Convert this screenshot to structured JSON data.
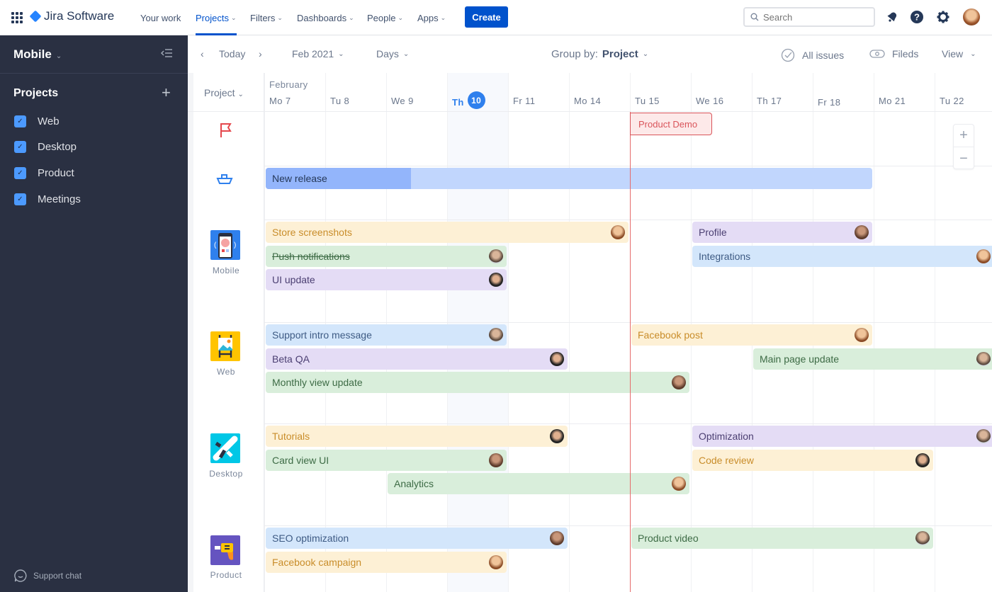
{
  "topbar": {
    "brand": "Jira Software",
    "nav": [
      {
        "label": "Your work",
        "dropdown": false,
        "active": false
      },
      {
        "label": "Projects",
        "dropdown": true,
        "active": true
      },
      {
        "label": "Filters",
        "dropdown": true,
        "active": false
      },
      {
        "label": "Dashboards",
        "dropdown": true,
        "active": false
      },
      {
        "label": "People",
        "dropdown": true,
        "active": false
      },
      {
        "label": "Apps",
        "dropdown": true,
        "active": false
      }
    ],
    "create_label": "Create",
    "search_placeholder": "Search",
    "icons": [
      "notifications-icon",
      "help-icon",
      "settings-icon",
      "user-avatar"
    ]
  },
  "sidebar": {
    "title": "Mobile",
    "projects_label": "Projects",
    "items": [
      {
        "label": "Web",
        "checked": true
      },
      {
        "label": "Desktop",
        "checked": true
      },
      {
        "label": "Product",
        "checked": true
      },
      {
        "label": "Meetings",
        "checked": true
      }
    ],
    "support_label": "Support chat"
  },
  "toolbar": {
    "today_label": "Today",
    "month_label": "Feb 2021",
    "scale_label": "Days",
    "group_by_label": "Group by:",
    "group_by_value": "Project",
    "all_issues_label": "All issues",
    "fields_label": "Fileds",
    "view_label": "View"
  },
  "timeline": {
    "project_header": "Project",
    "month": "February",
    "days": [
      {
        "label": "Mo 7"
      },
      {
        "label": "Tu 8"
      },
      {
        "label": "We 9"
      },
      {
        "label": "Th",
        "num": "10",
        "today": true
      },
      {
        "label": "Fr 11"
      },
      {
        "label": "Mo 14"
      },
      {
        "label": "Tu 15"
      },
      {
        "label": "We 16"
      },
      {
        "label": "Th 17"
      },
      {
        "label": "Fr 18"
      },
      {
        "label": "Mo 21"
      },
      {
        "label": "Tu 22"
      }
    ],
    "milestone": {
      "label": "Product Demo",
      "date": "Tu 15"
    },
    "release": {
      "label": "New release",
      "start": "Mo 7",
      "end": "Fr 18",
      "progress": 0.24
    },
    "groups": [
      {
        "name": "Mobile",
        "tasks": [
          {
            "label": "Store screenshots",
            "color": "yellow",
            "start": 0,
            "end": 6
          },
          {
            "label": "Push notifications",
            "color": "green",
            "start": 0,
            "end": 4,
            "done": true
          },
          {
            "label": "UI update",
            "color": "purple",
            "start": 0,
            "end": 4
          },
          {
            "label": "Profile",
            "color": "purple",
            "start": 7,
            "end": 10
          },
          {
            "label": "Integrations",
            "color": "blue",
            "start": 7,
            "end": 12
          }
        ]
      },
      {
        "name": "Web",
        "tasks": [
          {
            "label": "Support intro message",
            "color": "blue",
            "start": 0,
            "end": 4
          },
          {
            "label": "Beta QA",
            "color": "purple",
            "start": 0,
            "end": 5
          },
          {
            "label": "Monthly view update",
            "color": "green",
            "start": 0,
            "end": 7
          },
          {
            "label": "Facebook post",
            "color": "yellow",
            "start": 6,
            "end": 10
          },
          {
            "label": "Main page update",
            "color": "green",
            "start": 8,
            "end": 12
          }
        ]
      },
      {
        "name": "Desktop",
        "tasks": [
          {
            "label": "Tutorials",
            "color": "yellow",
            "start": 0,
            "end": 5
          },
          {
            "label": "Card view UI",
            "color": "green",
            "start": 0,
            "end": 4
          },
          {
            "label": "Analytics",
            "color": "green",
            "start": 2,
            "end": 7
          },
          {
            "label": "Optimization",
            "color": "purple",
            "start": 7,
            "end": 12
          },
          {
            "label": "Code review",
            "color": "yellow",
            "start": 7,
            "end": 11
          }
        ]
      },
      {
        "name": "Product",
        "tasks": [
          {
            "label": "SEO optimization",
            "color": "blue",
            "start": 0,
            "end": 5
          },
          {
            "label": "Facebook campaign",
            "color": "yellow",
            "start": 0,
            "end": 4
          },
          {
            "label": "Product video",
            "color": "green",
            "start": 6,
            "end": 11
          }
        ]
      }
    ]
  }
}
